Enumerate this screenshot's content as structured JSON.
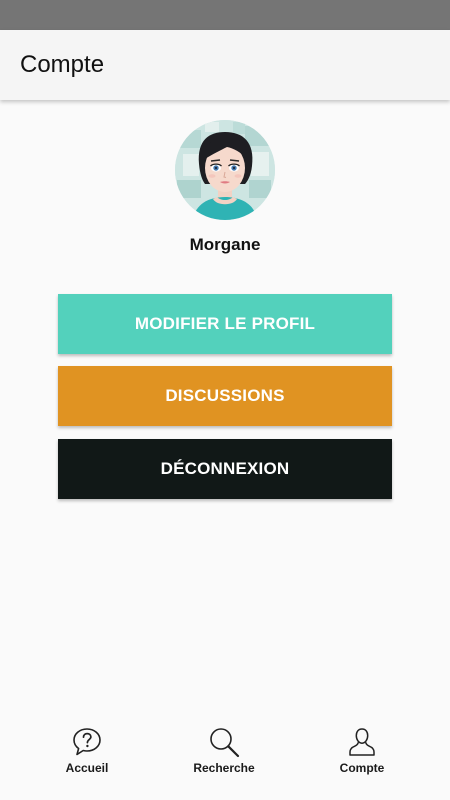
{
  "app_bar": {
    "title": "Compte"
  },
  "profile": {
    "avatar_icon": "user-avatar-portrait",
    "name": "Morgane"
  },
  "buttons": {
    "edit_profile": "MODIFIER LE PROFIL",
    "discussions": "DISCUSSIONS",
    "logout": "DÉCONNEXION"
  },
  "colors": {
    "status_bar": "#757575",
    "edit_profile": "#53d1bc",
    "discussions": "#e09322",
    "logout": "#111817"
  },
  "bottom_nav": {
    "items": [
      {
        "label": "Accueil",
        "icon": "speech-bubble-question-icon"
      },
      {
        "label": "Recherche",
        "icon": "search-icon"
      },
      {
        "label": "Compte",
        "icon": "user-icon"
      }
    ]
  }
}
